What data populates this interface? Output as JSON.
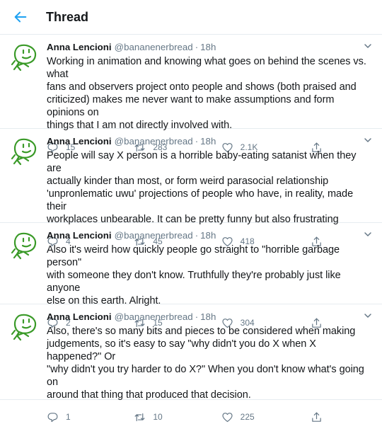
{
  "header": {
    "title": "Thread"
  },
  "colors": {
    "accent": "#1da1f2",
    "muted": "#657786",
    "avatar_stroke": "#3a9a28"
  },
  "icons": {
    "back": "back-arrow-icon",
    "reply": "reply-icon",
    "retweet": "retweet-icon",
    "like": "heart-icon",
    "share": "share-icon",
    "more": "chevron-down-icon"
  },
  "tweets": [
    {
      "name": "Anna Lencioni",
      "handle": "@bananenerbread",
      "separator": "·",
      "time": "18h",
      "text": "Working in animation and knowing what goes on behind the scenes vs. what\nfans and observers project onto people and shows (both praised and\ncriticized) makes me never want to make assumptions and form opinions on\nthings that I am not directly involved with.",
      "replies": "15",
      "retweets": "283",
      "likes": "2.1K"
    },
    {
      "name": "Anna Lencioni",
      "handle": "@bananenerbread",
      "separator": "·",
      "time": "18h",
      "text": "People will say X person is a horrible baby-eating satanist when they are\nactually kinder than most, or form weird parasocial relationship\n'unpronlematic uwu' projections of people who have, in reality, made their\nworkplaces unbearable. It can be pretty funny but also frustrating",
      "replies": "4",
      "retweets": "45",
      "likes": "418"
    },
    {
      "name": "Anna Lencioni",
      "handle": "@bananenerbread",
      "separator": "·",
      "time": "18h",
      "text": "Also it's weird how quickly people go straight to \"horrible garbage person\"\nwith someone they don't know. Truthfully they're probably just like anyone\nelse on this earth. Alright.",
      "replies": "2",
      "retweets": "15",
      "likes": "304"
    },
    {
      "name": "Anna Lencioni",
      "handle": "@bananenerbread",
      "separator": "·",
      "time": "18h",
      "text": "Also, there's so many bits and pieces to be considered when making\njudgements, so it's easy to say \"why didn't you do X when X happened?\" Or\n\"why didn't you try harder to do X?\" When you don't know what's going on\naround that thing that produced that decision.",
      "replies": "1",
      "retweets": "10",
      "likes": "225"
    }
  ]
}
